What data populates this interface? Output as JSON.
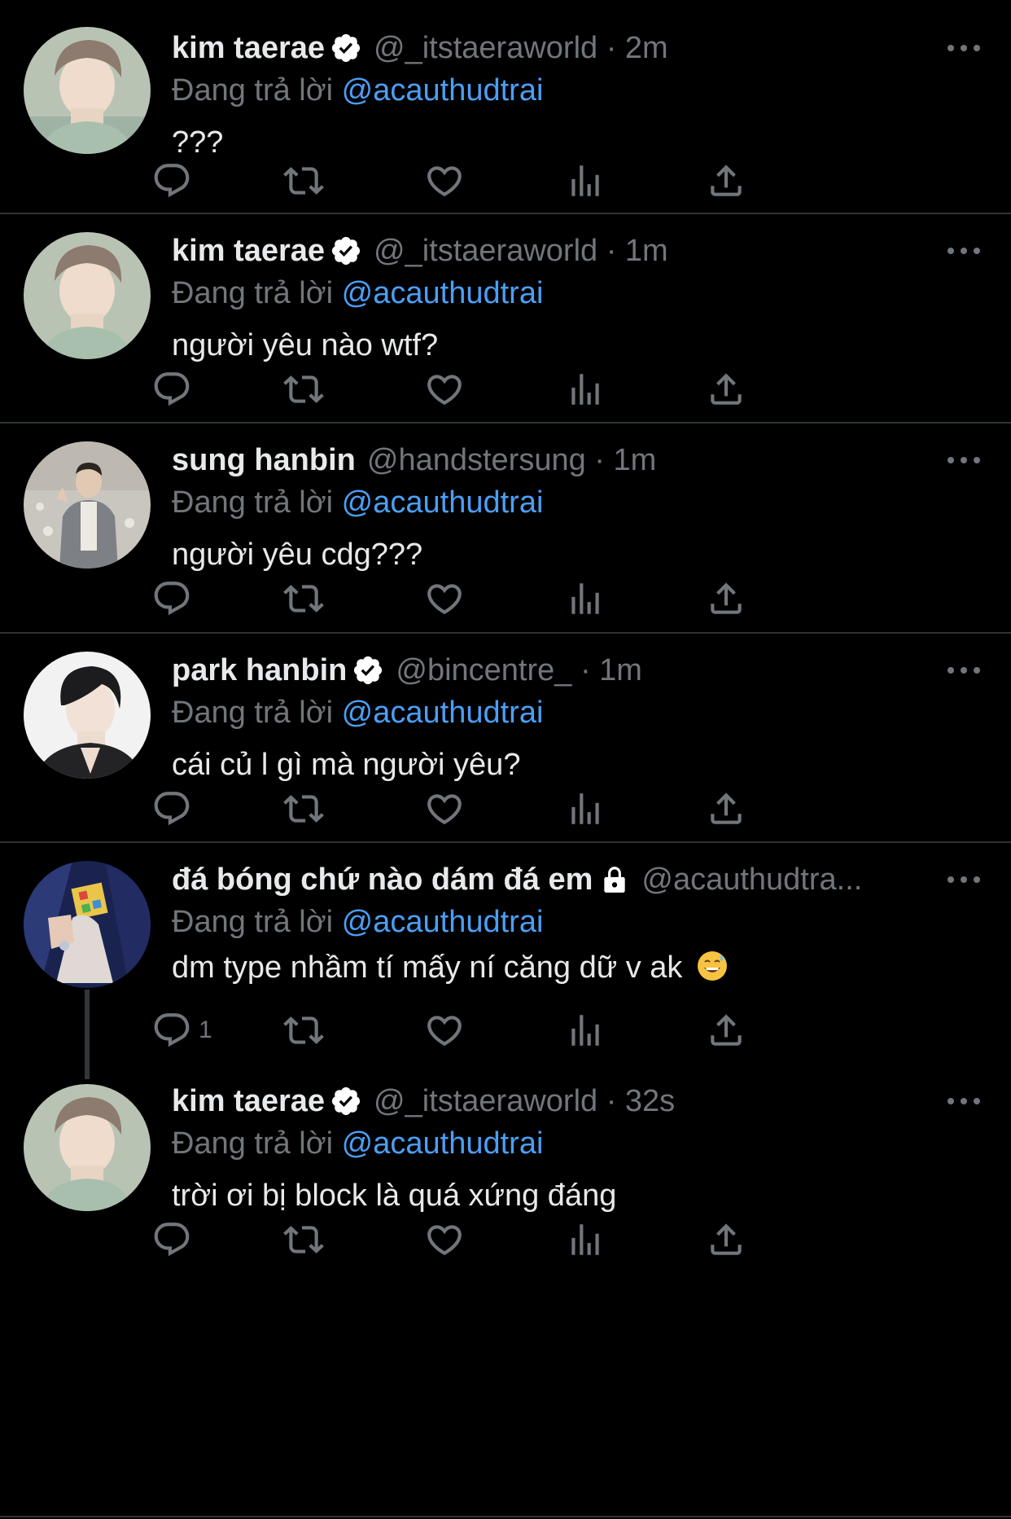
{
  "reply_prefix": "Đang trả lời",
  "colors": {
    "background": "#000000",
    "text": "#e7e9ea",
    "muted": "#71767b",
    "link": "#4a9ff5",
    "separator": "#2f3336",
    "verified_badge": "#ffffff"
  },
  "tweets": [
    {
      "name": "kim taerae",
      "verified": true,
      "handle": "@_itstaeraworld",
      "time": "2m",
      "meta": "@_itstaeraworld · 2m",
      "reply_to": "@acauthudtrai",
      "text": "???",
      "avatar": "photo-young-man-light-hair",
      "reply_count": ""
    },
    {
      "name": "kim taerae",
      "verified": true,
      "handle": "@_itstaeraworld",
      "time": "1m",
      "meta": "@_itstaeraworld · 1m",
      "reply_to": "@acauthudtrai",
      "text": "người yêu nào wtf?",
      "avatar": "photo-young-man-light-hair",
      "reply_count": ""
    },
    {
      "name": "sung hanbin",
      "verified": false,
      "handle": "@handstersung",
      "time": "1m",
      "meta": "@handstersung · 1m",
      "reply_to": "@acauthudtrai",
      "text": "người yêu cdg???",
      "avatar": "photo-man-peace-sign",
      "reply_count": ""
    },
    {
      "name": "park hanbin",
      "verified": true,
      "handle": "@bincentre_",
      "time": "1m",
      "meta": "@bincentre_ · 1m",
      "reply_to": "@acauthudtrai",
      "text": "cái củ l gì mà người yêu?",
      "avatar": "photo-man-dark-hair",
      "reply_count": ""
    },
    {
      "name": "đá bóng chứ nào dám đá em",
      "verified": false,
      "locked": true,
      "handle": "@acauthudtra...",
      "meta": "@acauthudtra...",
      "reply_to": "@acauthudtrai",
      "text": "dm type nhầm tí mấy ní căng dữ v ak",
      "emoji": "grinning-sweat-emoji",
      "avatar": "photo-hands-rubik-cube",
      "reply_count": "1"
    },
    {
      "name": "kim taerae",
      "verified": true,
      "handle": "@_itstaeraworld",
      "time": "32s",
      "meta": "@_itstaeraworld · 32s",
      "reply_to": "@acauthudtrai",
      "text": "trời ơi bị block là quá xứng đáng",
      "avatar": "photo-young-man-light-hair",
      "reply_count": ""
    }
  ]
}
